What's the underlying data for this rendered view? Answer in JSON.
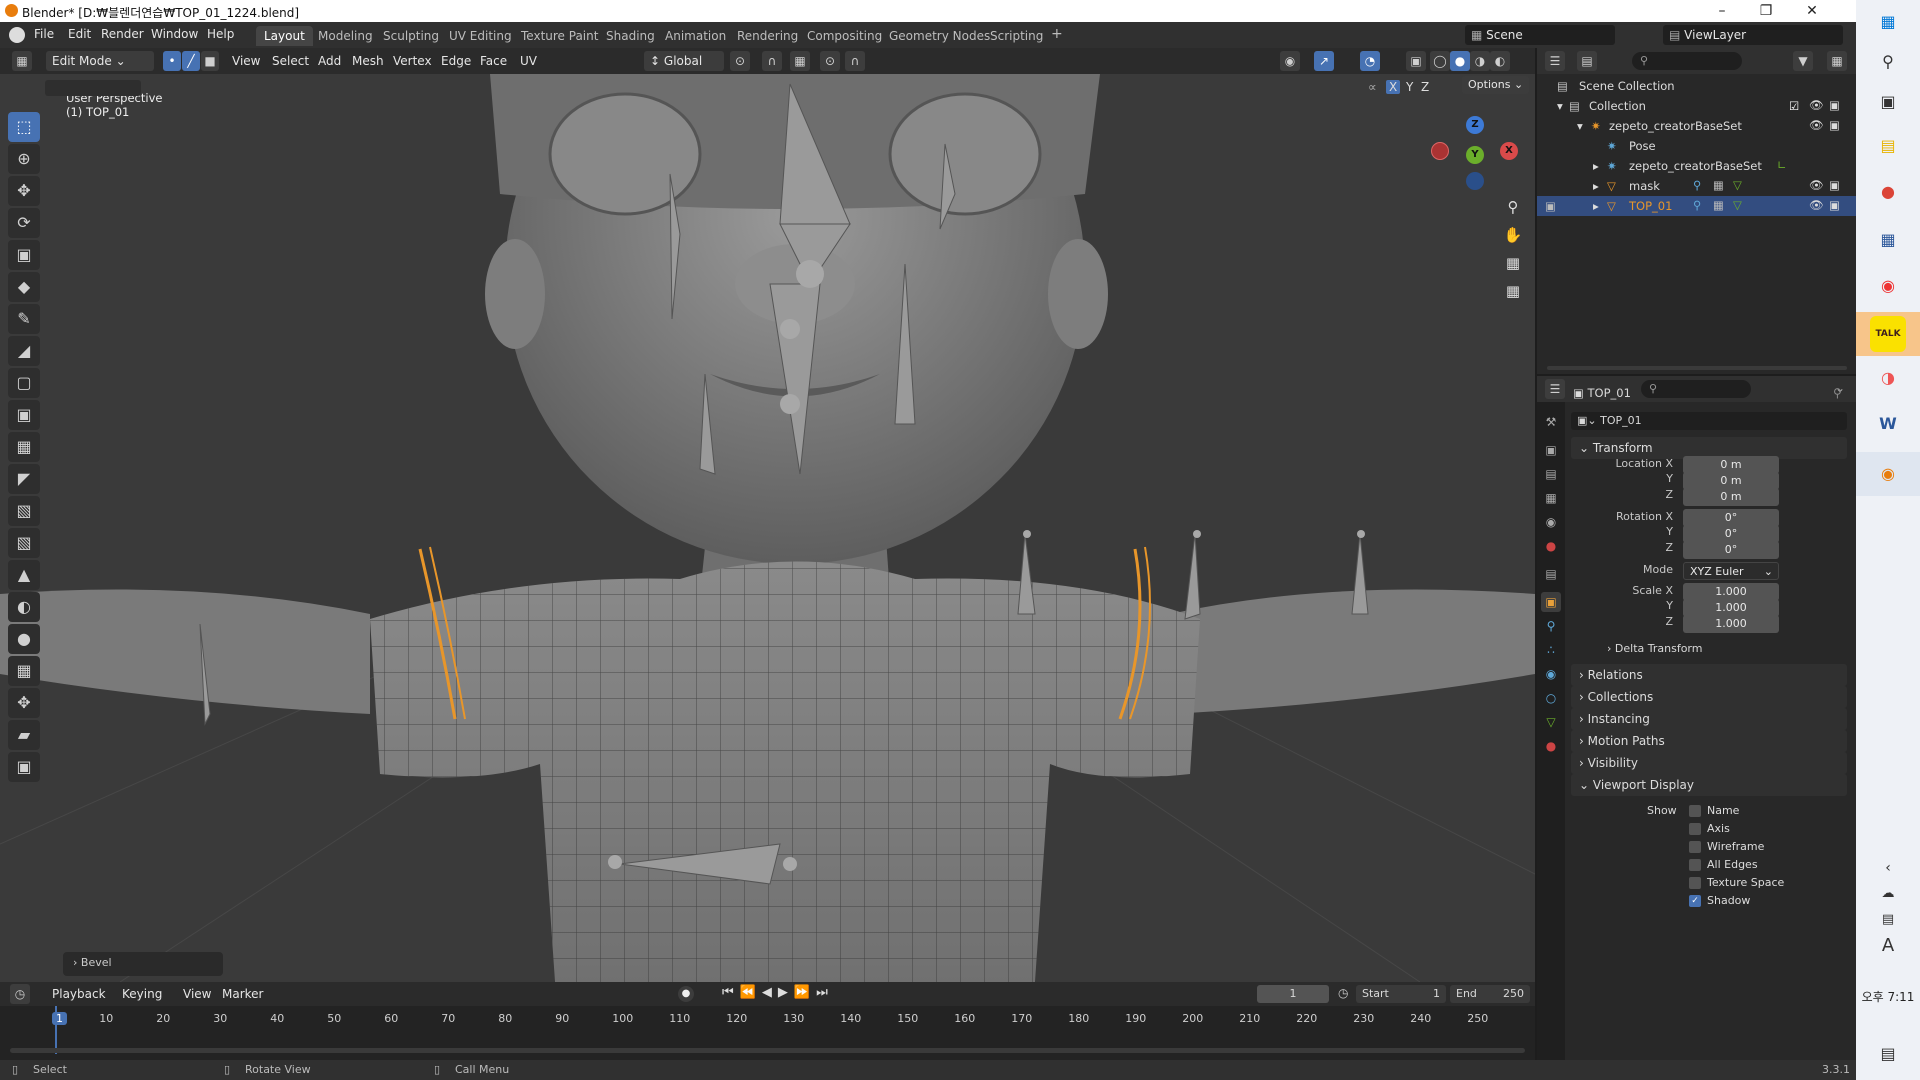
{
  "window": {
    "title": "Blender* [D:₩블렌더연습₩TOP_01_1224.blend]"
  },
  "menu": [
    "File",
    "Edit",
    "Render",
    "Window",
    "Help"
  ],
  "workspaces": [
    "Layout",
    "Modeling",
    "Sculpting",
    "UV Editing",
    "Texture Paint",
    "Shading",
    "Animation",
    "Rendering",
    "Compositing",
    "Geometry Nodes",
    "Scripting"
  ],
  "scene": {
    "name": "Scene",
    "view_layer": "ViewLayer"
  },
  "viewport_header": {
    "mode": "Edit Mode",
    "menus": [
      "View",
      "Select",
      "Add",
      "Mesh",
      "Vertex",
      "Edge",
      "Face",
      "UV"
    ],
    "orientation": "Global",
    "axes": [
      "X",
      "Y",
      "Z"
    ],
    "options": "Options"
  },
  "viewport": {
    "perspective": "User Perspective",
    "object": "(1) TOP_01",
    "operator_panel": "Bevel"
  },
  "outliner": {
    "rows": [
      {
        "label": "Scene Collection"
      },
      {
        "label": "Collection"
      },
      {
        "label": "zepeto_creatorBaseSet"
      },
      {
        "label": "Pose"
      },
      {
        "label": "zepeto_creatorBaseSet"
      },
      {
        "label": "mask"
      },
      {
        "label": "TOP_01"
      }
    ]
  },
  "properties": {
    "object_name": "TOP_01",
    "data_name": "TOP_01",
    "transform": {
      "title": "Transform",
      "location_label": "Location X",
      "location": [
        "0 m",
        "0 m",
        "0 m"
      ],
      "rotation_label": "Rotation X",
      "rotation": [
        "0°",
        "0°",
        "0°"
      ],
      "mode_label": "Mode",
      "mode": "XYZ Euler",
      "scale_label": "Scale X",
      "scale": [
        "1.000",
        "1.000",
        "1.000"
      ],
      "y": "Y",
      "z": "Z",
      "delta": "Delta Transform"
    },
    "panels": [
      "Relations",
      "Collections",
      "Instancing",
      "Motion Paths",
      "Visibility",
      "Viewport Display"
    ],
    "viewport_display": {
      "show_label": "Show",
      "options": [
        {
          "label": "Name",
          "checked": false
        },
        {
          "label": "Axis",
          "checked": false
        },
        {
          "label": "Wireframe",
          "checked": false
        },
        {
          "label": "All Edges",
          "checked": false
        },
        {
          "label": "Texture Space",
          "checked": false
        },
        {
          "label": "Shadow",
          "checked": true
        }
      ]
    }
  },
  "timeline": {
    "menus": [
      "Playback",
      "Keying",
      "View",
      "Marker"
    ],
    "current_frame": "1",
    "start_label": "Start",
    "start": "1",
    "end_label": "End",
    "end": "250",
    "ticks": [
      "1",
      "10",
      "20",
      "30",
      "40",
      "50",
      "60",
      "70",
      "80",
      "90",
      "100",
      "110",
      "120",
      "130",
      "140",
      "150",
      "160",
      "170",
      "180",
      "190",
      "200",
      "210",
      "220",
      "230",
      "240",
      "250"
    ]
  },
  "statusbar": {
    "select": "Select",
    "rotate": "Rotate View",
    "call_menu": "Call Menu",
    "version": "3.3.1"
  },
  "taskbar": {
    "time": "오후 7:11",
    "lang": "A",
    "kakao": "TALK"
  },
  "colors": {
    "accent": "#4772b3",
    "selection_edge": "#e8962a",
    "active_row": "#334d80"
  }
}
